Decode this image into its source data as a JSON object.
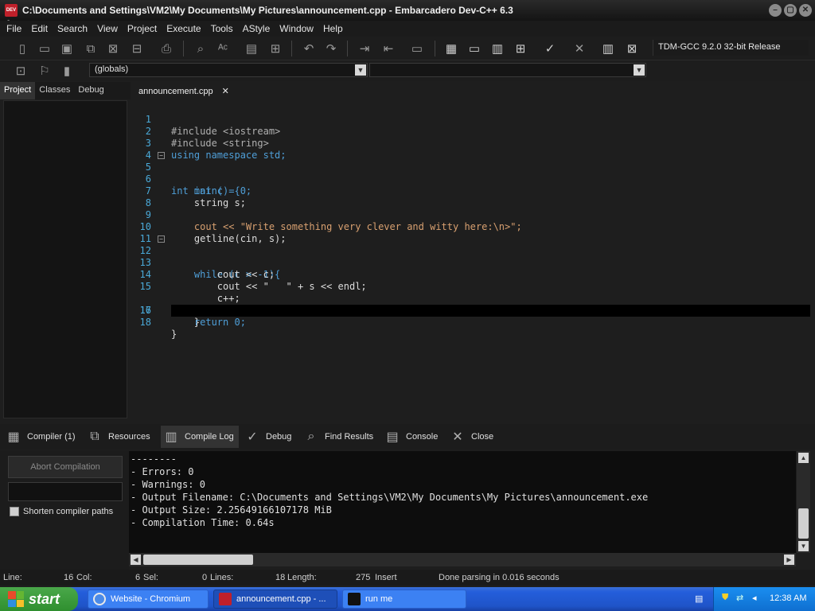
{
  "window": {
    "title": "C:\\Documents and Settings\\VM2\\My Documents\\My Pictures\\announcement.cpp - Embarcadero Dev-C++ 6.3",
    "app_icon_text": "DEV C++",
    "minimize": "–",
    "restore": "▢",
    "close": "✕"
  },
  "menu": [
    "File",
    "Edit",
    "Search",
    "View",
    "Project",
    "Execute",
    "Tools",
    "AStyle",
    "Window",
    "Help"
  ],
  "toolbar": {
    "compiler": "TDM-GCC 9.2.0 32-bit Release"
  },
  "toolbar2": {
    "scope_combo": "(globals)",
    "function_combo": ""
  },
  "left_tabs": [
    "Project",
    "Classes",
    "Debug"
  ],
  "editor": {
    "tab_label": "announcement.cpp",
    "tab_close": "✕",
    "line_numbers": [
      "1",
      "2",
      "3",
      "4",
      "5",
      "6",
      "7",
      "8",
      "9",
      "10",
      "11",
      "12",
      "13",
      "14",
      "15",
      "16",
      "17",
      "18"
    ],
    "lines": [
      "#include <iostream>",
      "#include <string>",
      "using namespace std;",
      "",
      "int main() {",
      "    int c = 0;",
      "    string s;",
      "",
      "    cout << \"Write something very clever and witty here:\\n>\";",
      "    getline(cin, s);",
      "",
      "    while (c > -1){",
      "        cout << c;",
      "        cout << \"   \" + s << endl;",
      "        c++;",
      "    }",
      "    return 0;",
      "}"
    ]
  },
  "bottom_tabs": [
    "Compiler (1)",
    "Resources",
    "Compile Log",
    "Debug",
    "Find Results",
    "Console",
    "Close"
  ],
  "bottom_panel": {
    "abort_button": "Abort Compilation",
    "shorten_paths_label": "Shorten compiler paths",
    "log_lines": [
      "--------",
      "- Errors: 0",
      "- Warnings: 0",
      "- Output Filename: C:\\Documents and Settings\\VM2\\My Documents\\My Pictures\\announcement.exe",
      "- Output Size: 2.25649166107178 MiB",
      "- Compilation Time: 0.64s"
    ]
  },
  "status": {
    "line_label": "Line:",
    "line_value": "16",
    "col_label": "Col:",
    "col_value": "6",
    "sel_label": "Sel:",
    "sel_value": "0",
    "lines_label": "Lines:",
    "lines_value": "18",
    "length_label": "Length:",
    "length_value": "275",
    "mode": "Insert",
    "message": "Done parsing in 0.016 seconds"
  },
  "taskbar": {
    "start": "start",
    "tasks": [
      "Website - Chromium",
      "announcement.cpp - ...",
      "run me"
    ],
    "clock": "12:38 AM"
  },
  "colors": {
    "keyword": "#4f9fd8",
    "string": "#d8a070",
    "line_number": "#4aa9d8",
    "taskbar": "#245edb",
    "start_button": "#3a9a3a"
  }
}
